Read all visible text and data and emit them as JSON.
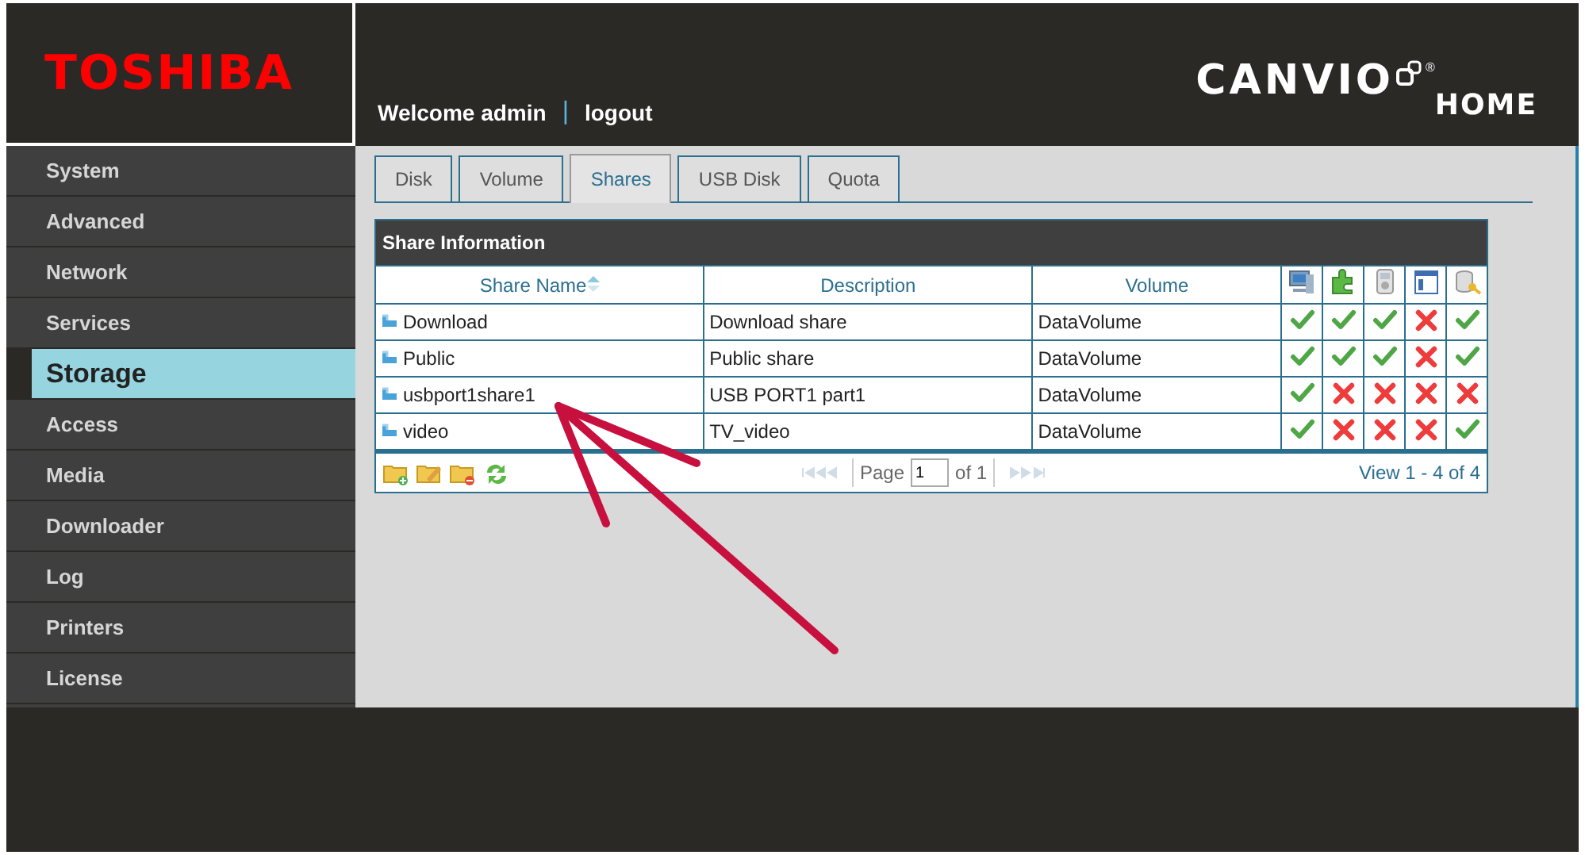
{
  "header": {
    "logo": "TOSHIBA",
    "welcome": "Welcome admin",
    "separator": "|",
    "logout": "logout",
    "product": {
      "name": "CANVIO",
      "mark": "®",
      "sub": "HOME"
    }
  },
  "sidebar": {
    "items": [
      {
        "label": "System",
        "selected": false
      },
      {
        "label": "Advanced",
        "selected": false
      },
      {
        "label": "Network",
        "selected": false
      },
      {
        "label": "Services",
        "selected": false
      },
      {
        "label": "Storage",
        "selected": true
      },
      {
        "label": "Access",
        "selected": false
      },
      {
        "label": "Media",
        "selected": false
      },
      {
        "label": "Downloader",
        "selected": false
      },
      {
        "label": "Log",
        "selected": false
      },
      {
        "label": "Printers",
        "selected": false
      },
      {
        "label": "License",
        "selected": false
      }
    ]
  },
  "tabs": [
    {
      "label": "Disk",
      "selected": false
    },
    {
      "label": "Volume",
      "selected": false
    },
    {
      "label": "Shares",
      "selected": true
    },
    {
      "label": "USB Disk",
      "selected": false
    },
    {
      "label": "Quota",
      "selected": false
    }
  ],
  "table": {
    "title": "Share Information",
    "columns": [
      {
        "label": "Share Name",
        "sorted": true
      },
      {
        "label": "Description",
        "sorted": false
      },
      {
        "label": "Volume",
        "sorted": false
      }
    ],
    "rows": [
      {
        "name": "Download",
        "description": "Download share",
        "volume": "DataVolume",
        "access": [
          true,
          true,
          true,
          false,
          true
        ]
      },
      {
        "name": "Public",
        "description": "Public share",
        "volume": "DataVolume",
        "access": [
          true,
          true,
          true,
          false,
          true
        ]
      },
      {
        "name": "usbport1share1",
        "description": "USB PORT1 part1",
        "volume": "DataVolume",
        "access": [
          true,
          false,
          false,
          false,
          false
        ]
      },
      {
        "name": "video",
        "description": "TV_video",
        "volume": "DataVolume",
        "access": [
          true,
          false,
          false,
          false,
          true
        ]
      }
    ],
    "pager": {
      "page_label": "Page",
      "page": "1",
      "of": "of 1",
      "view": "View 1 - 4 of 4"
    }
  }
}
